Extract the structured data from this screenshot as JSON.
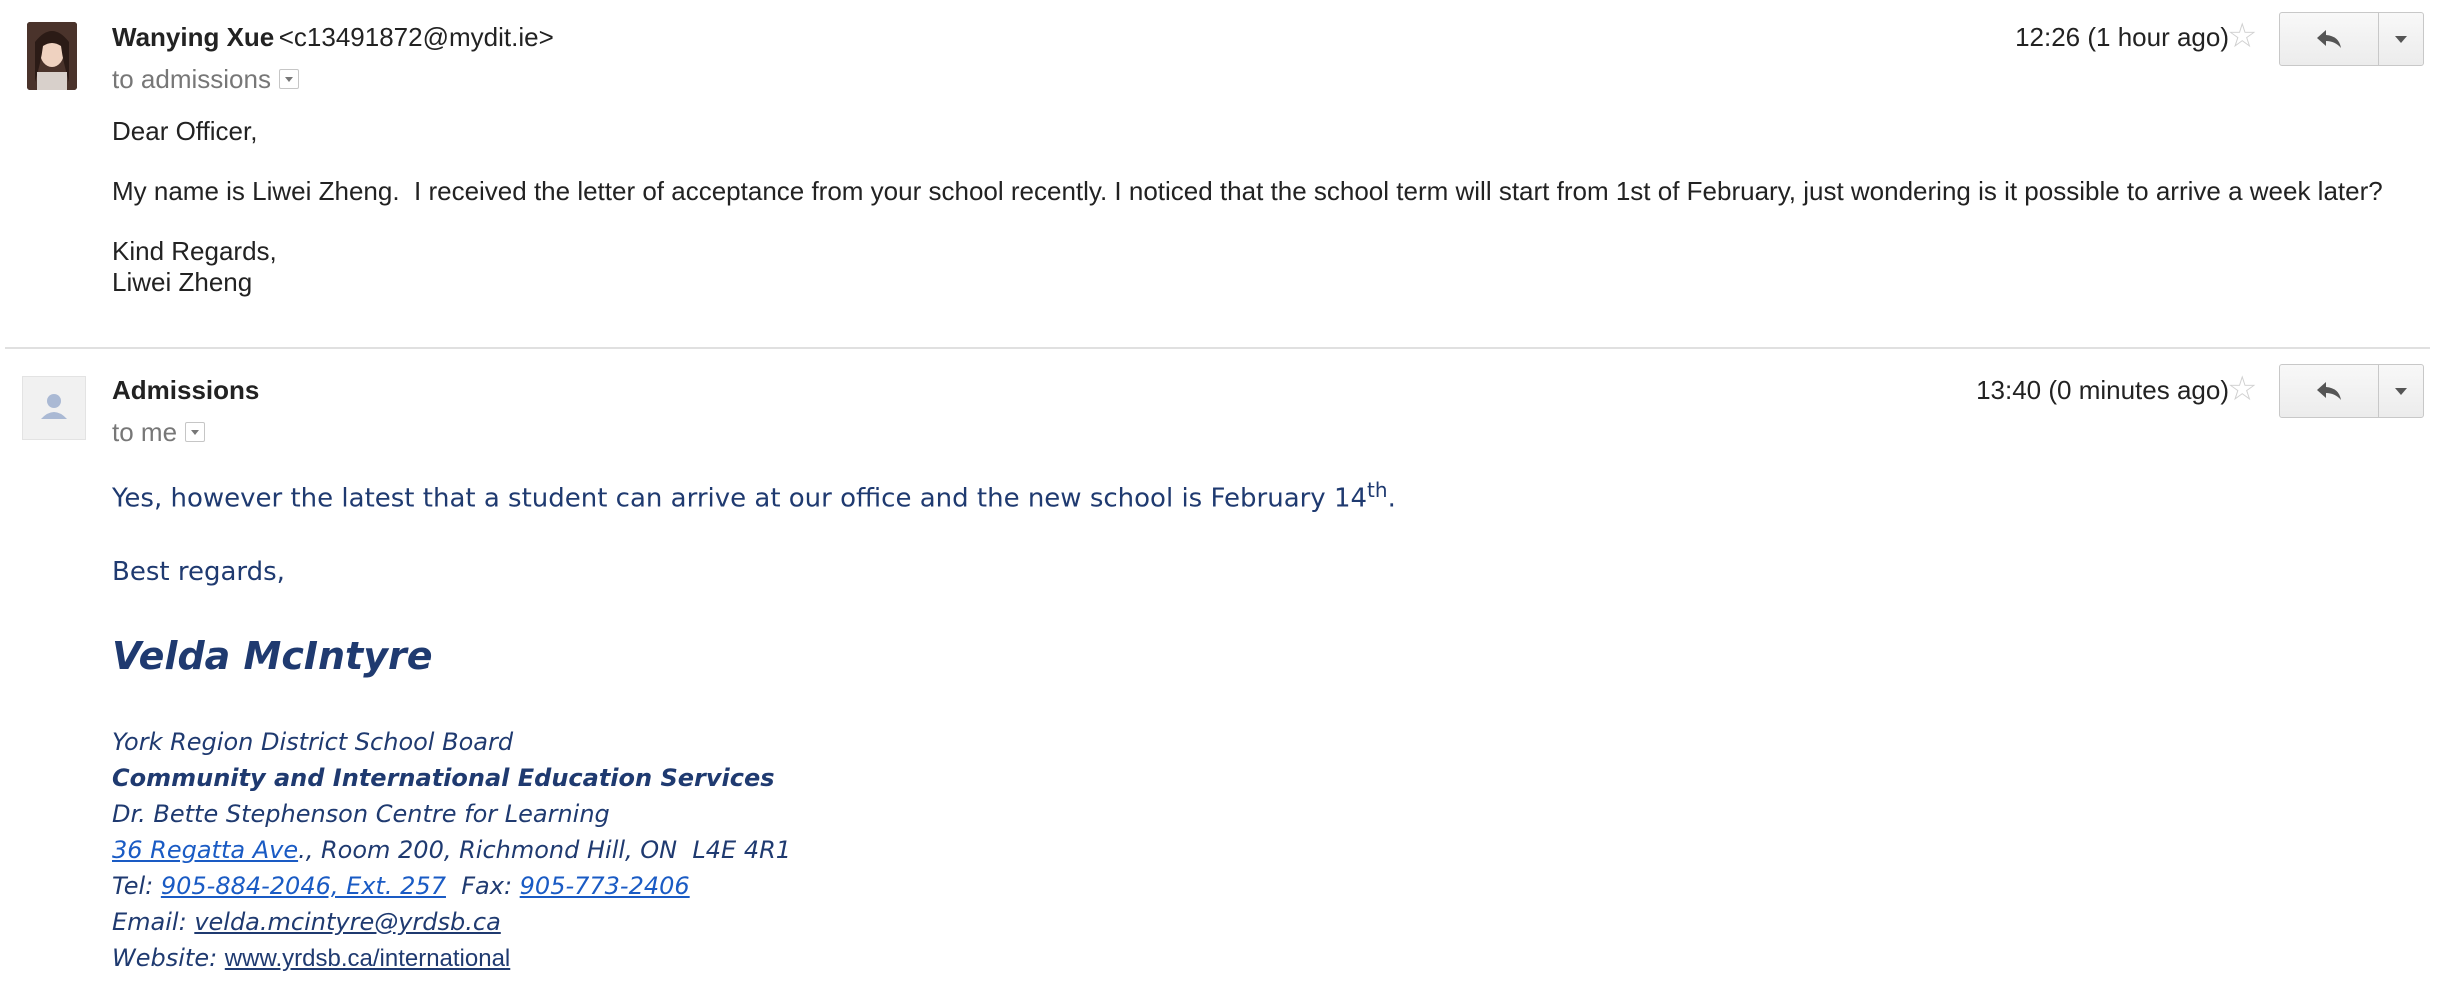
{
  "messages": [
    {
      "sender_name": "Wanying Xue",
      "sender_email": "<c13491872@mydit.ie>",
      "to": "to admissions",
      "time": "12:26 (1 hour ago)",
      "body": {
        "greeting": "Dear Officer,",
        "paragraph": "My name is Liwei Zheng.  I received the letter of acceptance from your school recently. I noticed that the school term will start from 1st of February, just wondering is it possible to arrive a week later?",
        "closing": "Kind Regards,",
        "signoff": "Liwei Zheng"
      }
    },
    {
      "sender_name": "Admissions",
      "to": "to me",
      "time": "13:40 (0 minutes ago)",
      "body": {
        "text_main": "Yes, however the latest that a student can arrive at our office and the new school is February 14",
        "text_sup": "th",
        "text_end": ".",
        "closing": "Best regards,",
        "signature": {
          "name": "Velda McIntyre",
          "org": "York Region District School Board",
          "dept": "Community and International Education Services",
          "centre": "Dr. Bette Stephenson Centre for Learning",
          "address_link": "36 Regatta Ave",
          "address_rest": "., Room 200, Richmond Hill, ON  L4E 4R1",
          "tel_label": "Tel: ",
          "tel_link": "905-884-2046, Ext. 257",
          "fax_label": "  Fax: ",
          "fax_link": "905-773-2406",
          "email_label": "Email: ",
          "email_link": "velda.mcintyre@yrdsb.ca",
          "website_label": "Website: ",
          "website_link": "www.yrdsb.ca/international"
        }
      }
    }
  ],
  "colors": {
    "signature_blue": "#1f3a70",
    "link_blue": "#1a5bc4",
    "muted_gray": "#777777"
  },
  "icons": [
    "star-icon",
    "reply-icon",
    "chevron-down-icon",
    "default-avatar-icon"
  ]
}
